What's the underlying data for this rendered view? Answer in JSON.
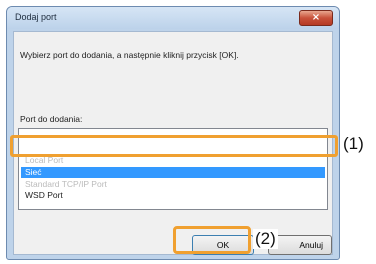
{
  "dialog": {
    "title": "Dodaj port",
    "close_icon": "×",
    "instruction": "Wybierz port do dodania, a następnie kliknij przycisk [OK].",
    "list_label": "Port do dodania:",
    "ports": [
      {
        "label": "Local Port"
      },
      {
        "label": "Sieć"
      },
      {
        "label": "Standard TCP/IP Port"
      },
      {
        "label": "WSD Port"
      }
    ],
    "ok_label": "OK",
    "cancel_label": "Anuluj"
  },
  "callouts": {
    "first": "(1)",
    "second": "(2)"
  },
  "colors": {
    "accent": "#f0a030",
    "selection": "#3399ff"
  }
}
